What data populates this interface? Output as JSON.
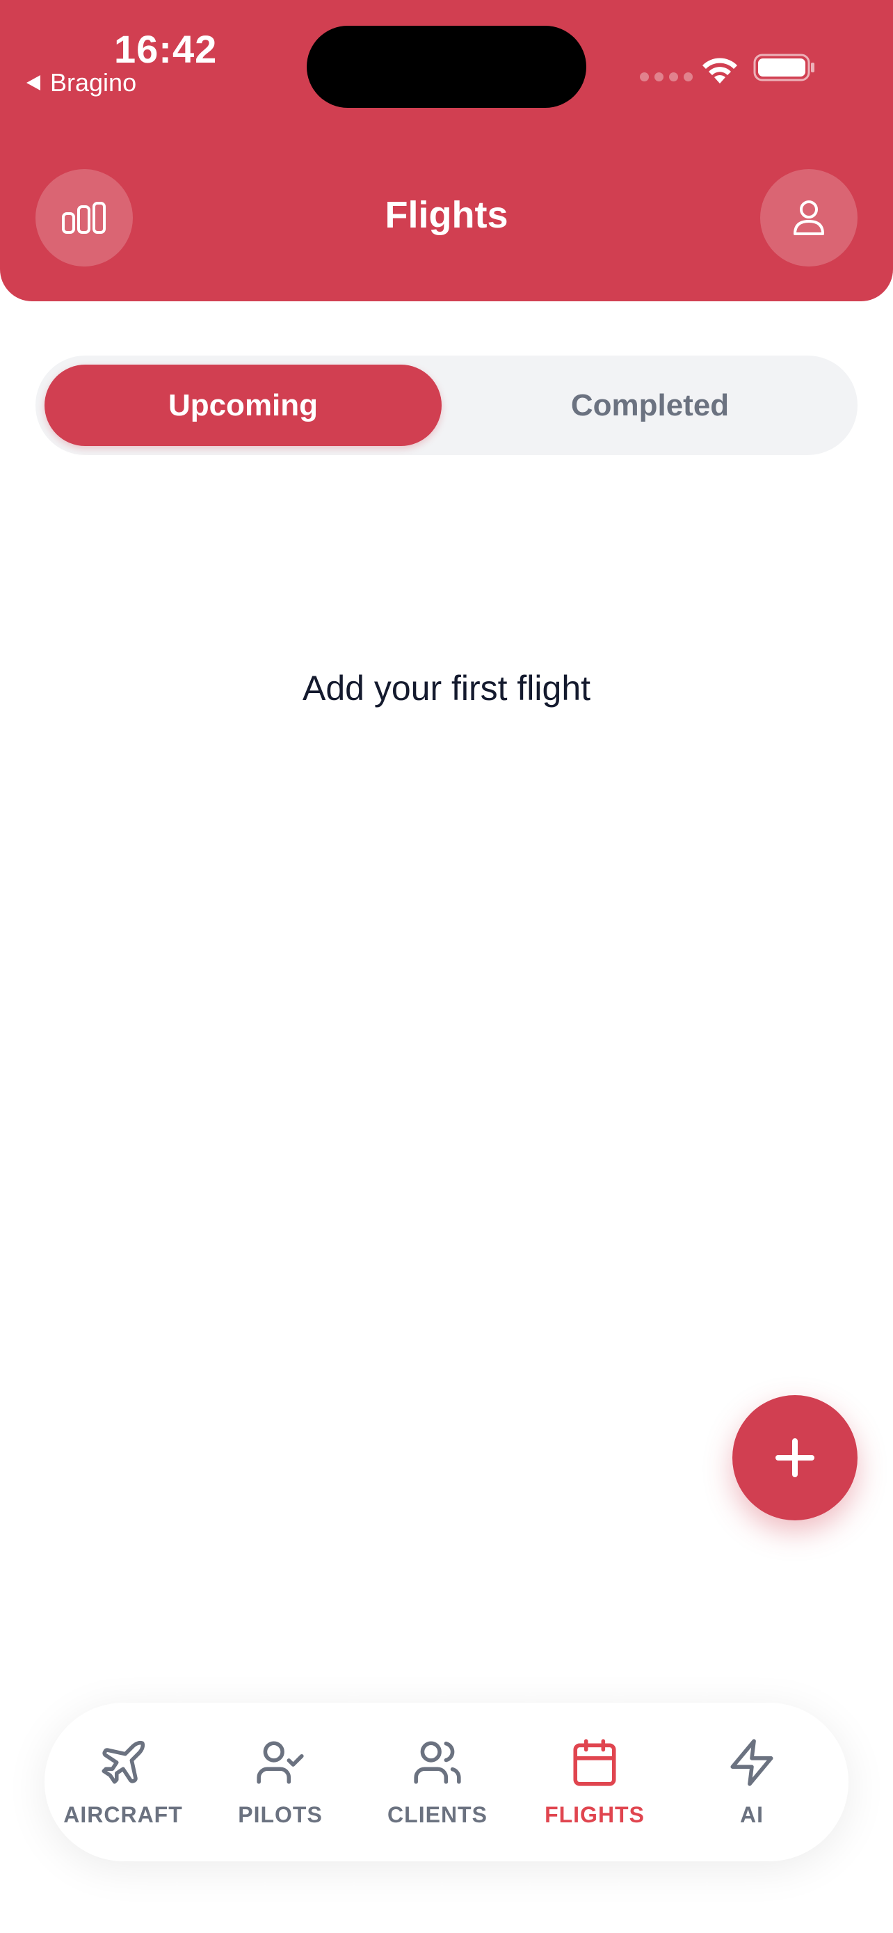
{
  "status_bar": {
    "time": "16:42",
    "back_app": "Bragino"
  },
  "header": {
    "title": "Flights",
    "left_icon": "bar-chart-icon",
    "right_icon": "user-icon"
  },
  "tabs": [
    {
      "label": "Upcoming",
      "active": true
    },
    {
      "label": "Completed",
      "active": false
    }
  ],
  "empty_state": {
    "message": "Add your first flight"
  },
  "fab": {
    "icon": "plus-icon"
  },
  "bottom_nav": {
    "items": [
      {
        "label": "AIRCRAFT",
        "icon": "airplane-icon",
        "active": false
      },
      {
        "label": "PILOTS",
        "icon": "user-check-icon",
        "active": false
      },
      {
        "label": "CLIENTS",
        "icon": "users-icon",
        "active": false
      },
      {
        "label": "FLIGHTS",
        "icon": "calendar-icon",
        "active": true
      },
      {
        "label": "AI",
        "icon": "lightning-icon",
        "active": false
      }
    ]
  },
  "colors": {
    "brand": "#d13f51",
    "active_nav": "#e0454f",
    "inactive": "#6b7280",
    "text_dark": "#141a2e"
  }
}
